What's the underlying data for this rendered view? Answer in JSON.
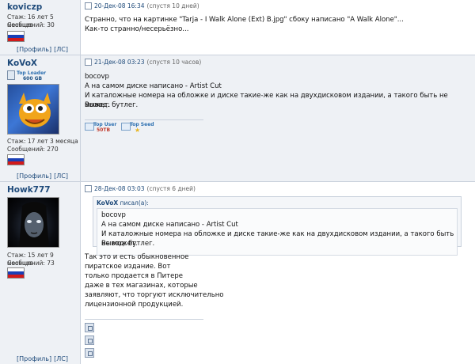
{
  "posts": [
    {
      "author": "koviczp",
      "stats": {
        "tenure": "Стаж: 16 лет 5 месяцев",
        "messages": "Сообщений: 30"
      },
      "profile": "[Профиль]",
      "pm": "[ЛС]",
      "date": "20-Дек-08 16:34",
      "since": "(спустя 10 дней)",
      "lines": [
        "Странно, что на картинке \"Tarja - I Walk Alone (Ext) B.jpg\" сбоку написано \"A Walk Alone\"...",
        "Как-то странно/несерьёзно..."
      ]
    },
    {
      "author": "KoVoX",
      "rank": "Top Loader",
      "rank_value": "600 GB",
      "stats": {
        "tenure": "Стаж: 17 лет 3 месяца",
        "messages": "Сообщений: 270"
      },
      "profile": "[Профиль]",
      "pm": "[ЛС]",
      "date": "21-Дек-08 03:23",
      "since": "(спустя 10 часов)",
      "lines": [
        "bocovp",
        "А на самом диске написано - Artist Cut",
        "И каталожные номера на обложке и диске такие-же как на двухдисковом издании, а такого быть не может.",
        "Вывод: бутлег."
      ],
      "badges": {
        "top_user": "Top User",
        "top_user_value": "50TB",
        "top_seed": "Top Seed"
      }
    },
    {
      "author": "Howk777",
      "stats": {
        "tenure": "Стаж: 15 лет 9 месяцев",
        "messages": "Сообщений: 73"
      },
      "profile": "[Профиль]",
      "pm": "[ЛС]",
      "date": "28-Дек-08 03:03",
      "since": "(спустя 6 дней)",
      "quote": {
        "author": "KoVoX",
        "wrote": "писал(а):",
        "lines": [
          "bocovp",
          "А на самом диске написано - Artist Cut",
          "И каталожные номера на обложке и диске такие-же как на двухдисковом издании, а такого быть не может.",
          "Вывод: бутлег."
        ]
      },
      "lines": [
        "Так это и есть обыкновенное",
        "пиратское издание. Вот",
        "только продается в Питере",
        "дажe в тех магазинах, которые",
        "заявляют, что торгуют исключительно",
        "лицензионной продукцией."
      ]
    }
  ]
}
